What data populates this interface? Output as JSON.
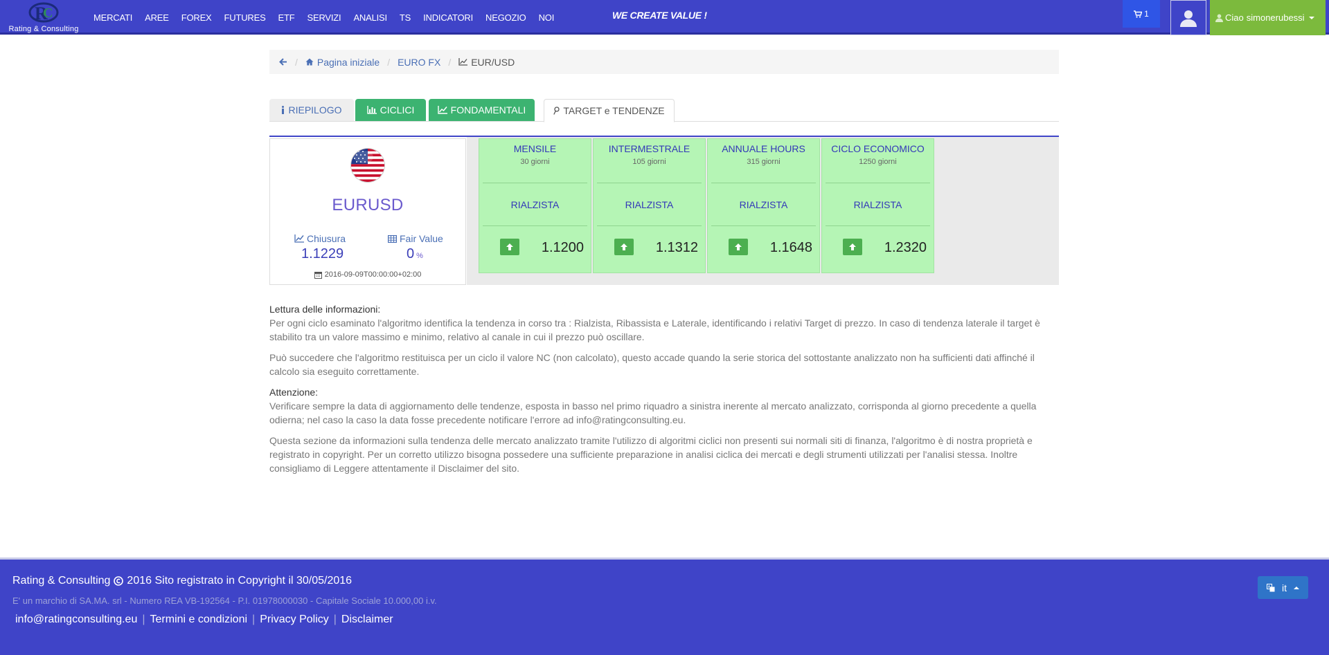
{
  "brand": {
    "name": "Rating & Consulting"
  },
  "nav": {
    "items": [
      "MERCATI",
      "AREE",
      "FOREX",
      "FUTURES",
      "ETF",
      "SERVIZI",
      "ANALISI",
      "TS",
      "INDICATORI",
      "NEGOZIO",
      "NOI"
    ],
    "slogan": "WE CREATE VALUE !",
    "cart_count": "1",
    "greeting": "Ciao",
    "username": "simonerubessi"
  },
  "breadcrumb": {
    "home": "Pagina iniziale",
    "parent": "EURO FX",
    "current": "EUR/USD"
  },
  "tabs": {
    "riepilogo": "RIEPILOGO",
    "ciclici": "CICLICI",
    "fondamentali": "FONDAMENTALI",
    "target": "TARGET e TENDENZE"
  },
  "summary": {
    "symbol": "EURUSD",
    "close_label": "Chiusura",
    "close_value": "1.1229",
    "fair_label": "Fair Value",
    "fair_value": "0",
    "fair_unit": "%",
    "date": "2016-09-09T00:00:00+02:00"
  },
  "cycles": [
    {
      "title": "MENSILE",
      "sub": "30 giorni",
      "trend": "RIALZISTA",
      "value": "1.1200"
    },
    {
      "title": "INTERMESTRALE",
      "sub": "105 giorni",
      "trend": "RIALZISTA",
      "value": "1.1312"
    },
    {
      "title": "ANNUALE HOURS",
      "sub": "315 giorni",
      "trend": "RIALZISTA",
      "value": "1.1648"
    },
    {
      "title": "CICLO ECONOMICO",
      "sub": "1250 giorni",
      "trend": "RIALZISTA",
      "value": "1.2320"
    }
  ],
  "info": {
    "h1": "Lettura delle informazioni:",
    "p1": "Per ogni ciclo esaminato l'algoritmo identifica la tendenza in corso tra : Rialzista, Ribassista e Laterale, identificando i relativi Target di prezzo. In caso di tendenza laterale il target è stabilito tra un valore massimo e minimo, relativo al canale in cui il prezzo può oscillare.",
    "p2": "Può succedere che l'algoritmo restituisca per un ciclo il valore NC (non calcolato), questo accade quando la serie storica del sottostante analizzato non ha sufficienti dati affinché il calcolo sia eseguito correttamente.",
    "h2": "Attenzione:",
    "p3": "Verificare sempre la data di aggiornamento delle tendenze, esposta in basso nel primo riquadro a sinistra inerente al mercato analizzato, corrisponda al giorno precedente a quella odierna; nel caso la caso la data fosse precedente notificare l'errore ad info@ratingconsulting.eu.",
    "p4": "Questa sezione da informazioni sulla tendenza delle mercato analizzato tramite l'utilizzo di algoritmi ciclici non presenti sui normali siti di finanza, l'algoritmo è di nostra proprietà e registrato in copyright. Per un corretto utilizzo bisogna possedere una sufficiente preparazione in analisi ciclica dei mercati e degli strumenti utilizzati per l'analisi stessa. Inoltre consigliamo di Leggere attentamente il Disclaimer del sito."
  },
  "footer": {
    "company": "Rating & Consulting",
    "copyright": "2016 Sito registrato in Copyright il 30/05/2016",
    "legal": "E' un marchio di SA.MA. srl - Numero REA VB-192564 - P.I. 01978000030 - Capitale Sociale 10.000,00 i.v.",
    "email": "info@ratingconsulting.eu",
    "terms": "Termini e condizioni",
    "privacy": "Privacy Policy",
    "disclaimer": "Disclaimer",
    "lang": "it"
  }
}
